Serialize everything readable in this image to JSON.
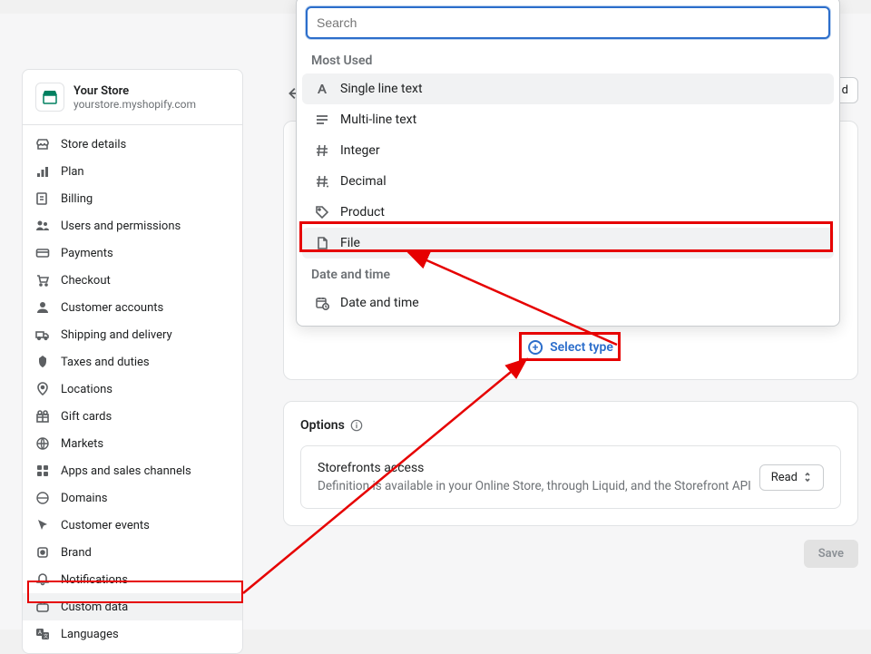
{
  "store": {
    "name": "Your Store",
    "url": "yourstore.myshopify.com"
  },
  "sidebar": {
    "items": [
      {
        "label": "Store details"
      },
      {
        "label": "Plan"
      },
      {
        "label": "Billing"
      },
      {
        "label": "Users and permissions"
      },
      {
        "label": "Payments"
      },
      {
        "label": "Checkout"
      },
      {
        "label": "Customer accounts"
      },
      {
        "label": "Shipping and delivery"
      },
      {
        "label": "Taxes and duties"
      },
      {
        "label": "Locations"
      },
      {
        "label": "Gift cards"
      },
      {
        "label": "Markets"
      },
      {
        "label": "Apps and sales channels"
      },
      {
        "label": "Domains"
      },
      {
        "label": "Customer events"
      },
      {
        "label": "Brand"
      },
      {
        "label": "Notifications"
      },
      {
        "label": "Custom data"
      },
      {
        "label": "Languages"
      }
    ]
  },
  "header": {
    "discard": "d"
  },
  "dropdown": {
    "search_placeholder": "Search",
    "groups": {
      "most_used": {
        "label": "Most Used",
        "items": [
          {
            "label": "Single line text"
          },
          {
            "label": "Multi-line text"
          },
          {
            "label": "Integer"
          },
          {
            "label": "Decimal"
          },
          {
            "label": "Product"
          },
          {
            "label": "File"
          }
        ]
      },
      "date_time": {
        "label": "Date and time",
        "items": [
          {
            "label": "Date and time"
          }
        ]
      }
    }
  },
  "select_type_label": "Select type",
  "options": {
    "title": "Options",
    "storefront_title": "Storefronts access",
    "storefront_desc": "Definition is available in your Online Store, through Liquid, and the Storefront API",
    "read_label": "Read"
  },
  "buttons": {
    "save": "Save"
  },
  "annotation": {
    "color": "#e60000"
  }
}
